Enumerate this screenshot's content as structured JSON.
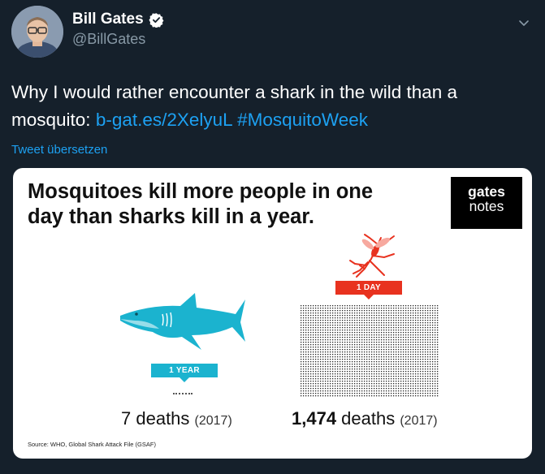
{
  "tweet": {
    "author_name": "Bill Gates",
    "handle": "@BillGates",
    "text": "Why I would rather encounter a shark in the wild than a mosquito: ",
    "link": "b-gat.es/2XelyuL",
    "hashtag": "#MosquitoWeek",
    "translate_label": "Tweet übersetzen"
  },
  "card": {
    "headline": "Mosquitoes kill more people in one day than sharks kill in a year.",
    "logo_line1": "gates",
    "logo_line2": "notes",
    "shark_label": "1 YEAR",
    "mosquito_label": "1 DAY",
    "shark_deaths_num": "7",
    "shark_deaths_word": " deaths ",
    "shark_year": "(2017)",
    "mosq_deaths_num": "1,474",
    "mosq_deaths_word": " deaths ",
    "mosq_year": "(2017)",
    "source": "Source: WHO, Global Shark Attack File (GSAF)"
  },
  "colors": {
    "background": "#15202b",
    "link": "#1da1f2",
    "shark": "#1bb3cf",
    "mosquito": "#e8321f"
  },
  "icons": {
    "verified": "verified-badge-icon",
    "caret": "chevron-down-icon"
  }
}
